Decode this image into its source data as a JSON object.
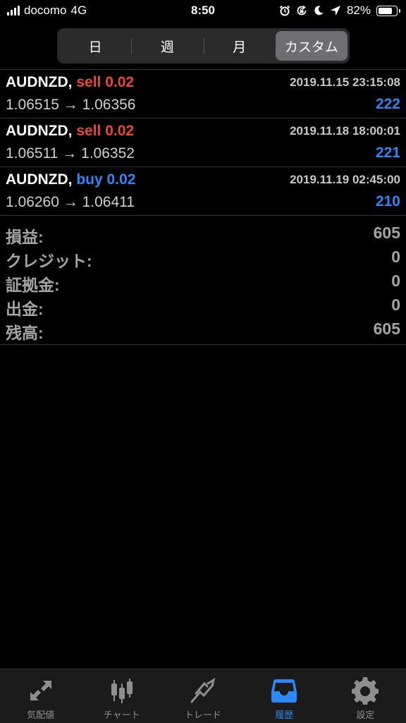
{
  "status_bar": {
    "carrier": "docomo",
    "network": "4G",
    "time": "8:50",
    "battery_percent": "82%",
    "battery_level": 0.82,
    "icons": [
      "signal-icon",
      "alarm-icon",
      "orientation-lock-icon",
      "moon-icon",
      "location-icon",
      "battery-icon"
    ]
  },
  "segments": [
    {
      "label": "日",
      "active": false
    },
    {
      "label": "週",
      "active": false
    },
    {
      "label": "月",
      "active": false
    },
    {
      "label": "カスタム",
      "active": true
    }
  ],
  "trades": [
    {
      "symbol": "AUDNZD,",
      "side": "sell 0.02",
      "side_type": "sell",
      "time": "2019.11.15 23:15:08",
      "prices": "1.06515 → 1.06356",
      "profit": "222"
    },
    {
      "symbol": "AUDNZD,",
      "side": "sell 0.02",
      "side_type": "sell",
      "time": "2019.11.18 18:00:01",
      "prices": "1.06511 → 1.06352",
      "profit": "221"
    },
    {
      "symbol": "AUDNZD,",
      "side": "buy 0.02",
      "side_type": "buy",
      "time": "2019.11.19 02:45:00",
      "prices": "1.06260 → 1.06411",
      "profit": "210"
    }
  ],
  "summary": [
    {
      "label": "損益:",
      "value": "605"
    },
    {
      "label": "クレジット:",
      "value": "0"
    },
    {
      "label": "証拠金:",
      "value": "0"
    },
    {
      "label": "出金:",
      "value": "0"
    },
    {
      "label": "残高:",
      "value": "605"
    }
  ],
  "tabs": [
    {
      "label": "気配値",
      "icon": "quotes-icon",
      "active": false
    },
    {
      "label": "チャート",
      "icon": "chart-candles-icon",
      "active": false
    },
    {
      "label": "トレード",
      "icon": "trade-icon",
      "active": false
    },
    {
      "label": "履歴",
      "icon": "history-inbox-icon",
      "active": true
    },
    {
      "label": "設定",
      "icon": "gear-icon",
      "active": false
    }
  ],
  "colors": {
    "sell": "#e8473a",
    "buy": "#2f86f5",
    "profit": "#2f86f5",
    "active_tab": "#2f86f5",
    "inactive_tab": "#8e8e8e"
  }
}
